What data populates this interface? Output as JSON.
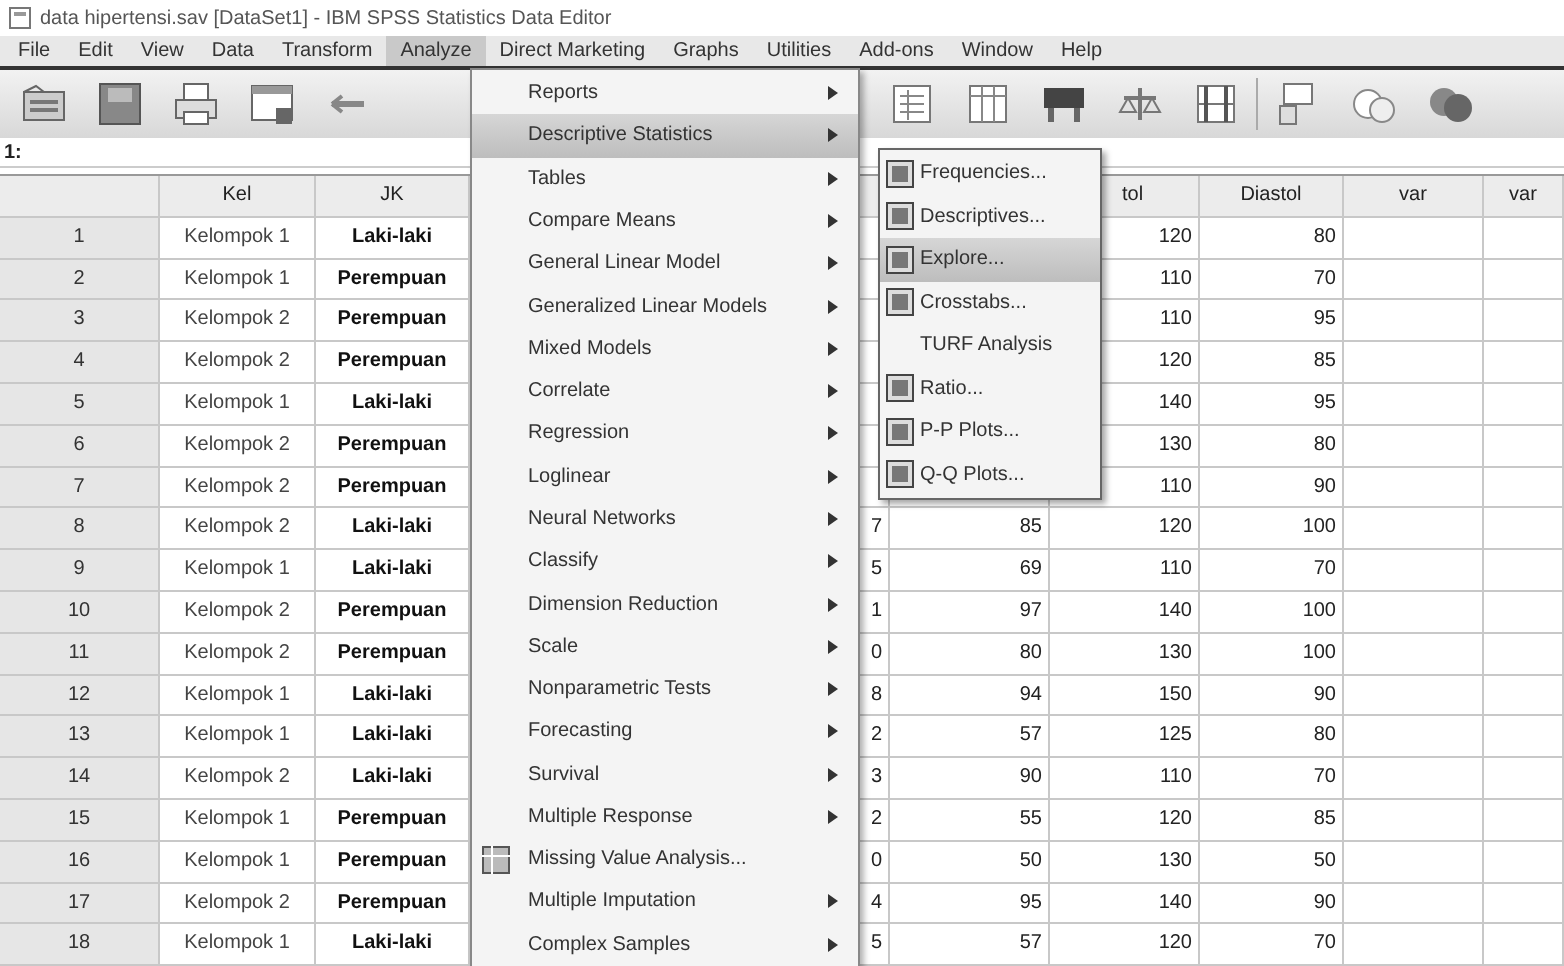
{
  "window": {
    "title": "data hipertensi.sav [DataSet1] - IBM SPSS Statistics Data Editor"
  },
  "menubar": [
    {
      "label": "File",
      "selected": false
    },
    {
      "label": "Edit",
      "selected": false
    },
    {
      "label": "View",
      "selected": false
    },
    {
      "label": "Data",
      "selected": false
    },
    {
      "label": "Transform",
      "selected": false
    },
    {
      "label": "Analyze",
      "selected": true
    },
    {
      "label": "Direct Marketing",
      "selected": false
    },
    {
      "label": "Graphs",
      "selected": false
    },
    {
      "label": "Utilities",
      "selected": false
    },
    {
      "label": "Add-ons",
      "selected": false
    },
    {
      "label": "Window",
      "selected": false
    },
    {
      "label": "Help",
      "selected": false
    }
  ],
  "cell_reference": "1:",
  "table": {
    "columns": [
      "Kel",
      "JK",
      "tol",
      "Diastol",
      "var",
      "var"
    ],
    "rows": [
      {
        "number": "1",
        "kelompok": "Kelompok 1",
        "jk": "Laki-laki",
        "sistol": "120",
        "diastol": "80"
      },
      {
        "number": "2",
        "kelompok": "Kelompok 1",
        "jk": "Perempuan",
        "sistol": "110",
        "diastol": "70"
      },
      {
        "number": "3",
        "kelompok": "Kelompok 2",
        "jk": "Perempuan",
        "sistol": "110",
        "diastol": "95"
      },
      {
        "number": "4",
        "kelompok": "Kelompok 2",
        "jk": "Perempuan",
        "sistol": "120",
        "diastol": "85"
      },
      {
        "number": "5",
        "kelompok": "Kelompok 1",
        "jk": "Laki-laki",
        "sistol": "140",
        "diastol": "95"
      },
      {
        "number": "6",
        "kelompok": "Kelompok 2",
        "jk": "Perempuan",
        "sistol": "130",
        "diastol": "80"
      },
      {
        "number": "7",
        "kelompok": "Kelompok 2",
        "jk": "Perempuan",
        "sistol": "110",
        "diastol": "90"
      },
      {
        "number": "8",
        "kelompok": "Kelompok 2",
        "jk": "Laki-laki",
        "column_5": "7",
        "column_6": "85",
        "sistol": "120",
        "diastol": "100"
      },
      {
        "number": "9",
        "kelompok": "Kelompok 1",
        "jk": "Laki-laki",
        "column_5": "5",
        "column_6": "69",
        "sistol": "110",
        "diastol": "70"
      },
      {
        "number": "10",
        "kelompok": "Kelompok 2",
        "jk": "Perempuan",
        "column_5": "1",
        "column_6": "97",
        "sistol": "140",
        "diastol": "100"
      },
      {
        "number": "11",
        "kelompok": "Kelompok 2",
        "jk": "Perempuan",
        "column_5": "0",
        "column_6": "80",
        "sistol": "130",
        "diastol": "100"
      },
      {
        "number": "12",
        "kelompok": "Kelompok 1",
        "jk": "Laki-laki",
        "column_5": "8",
        "column_6": "94",
        "sistol": "150",
        "diastol": "90"
      },
      {
        "number": "13",
        "kelompok": "Kelompok 1",
        "jk": "Laki-laki",
        "column_5": "2",
        "column_6": "57",
        "sistol": "125",
        "diastol": "80"
      },
      {
        "number": "14",
        "kelompok": "Kelompok 2",
        "jk": "Laki-laki",
        "column_5": "3",
        "column_6": "90",
        "sistol": "110",
        "diastol": "70"
      },
      {
        "number": "15",
        "kelompok": "Kelompok 1",
        "jk": "Perempuan",
        "column_5": "2",
        "column_6": "55",
        "sistol": "120",
        "diastol": "85"
      },
      {
        "number": "16",
        "kelompok": "Kelompok 1",
        "jk": "Perempuan",
        "column_5": "0",
        "column_6": "50",
        "sistol": "130",
        "diastol": "50"
      },
      {
        "number": "17",
        "kelompok": "Kelompok 2",
        "jk": "Perempuan",
        "column_5": "4",
        "column_6": "95",
        "sistol": "140",
        "diastol": "90"
      },
      {
        "number": "18",
        "kelompok": "Kelompok 1",
        "jk": "Laki-laki",
        "column_5": "5",
        "column_6": "57",
        "sistol": "120",
        "diastol": "70"
      }
    ]
  },
  "analyze_menu": [
    {
      "label": "Reports",
      "submenu": true,
      "selected": false,
      "icon": false
    },
    {
      "label": "Descriptive Statistics",
      "submenu": true,
      "selected": true,
      "icon": false
    },
    {
      "label": "Tables",
      "submenu": true,
      "selected": false,
      "icon": false
    },
    {
      "label": "Compare Means",
      "submenu": true,
      "selected": false,
      "icon": false
    },
    {
      "label": "General Linear Model",
      "submenu": true,
      "selected": false,
      "icon": false
    },
    {
      "label": "Generalized Linear Models",
      "submenu": true,
      "selected": false,
      "icon": false
    },
    {
      "label": "Mixed Models",
      "submenu": true,
      "selected": false,
      "icon": false
    },
    {
      "label": "Correlate",
      "submenu": true,
      "selected": false,
      "icon": false
    },
    {
      "label": "Regression",
      "submenu": true,
      "selected": false,
      "icon": false
    },
    {
      "label": "Loglinear",
      "submenu": true,
      "selected": false,
      "icon": false
    },
    {
      "label": "Neural Networks",
      "submenu": true,
      "selected": false,
      "icon": false
    },
    {
      "label": "Classify",
      "submenu": true,
      "selected": false,
      "icon": false
    },
    {
      "label": "Dimension Reduction",
      "submenu": true,
      "selected": false,
      "icon": false
    },
    {
      "label": "Scale",
      "submenu": true,
      "selected": false,
      "icon": false
    },
    {
      "label": "Nonparametric Tests",
      "submenu": true,
      "selected": false,
      "icon": false
    },
    {
      "label": "Forecasting",
      "submenu": true,
      "selected": false,
      "icon": false
    },
    {
      "label": "Survival",
      "submenu": true,
      "selected": false,
      "icon": false
    },
    {
      "label": "Multiple Response",
      "submenu": true,
      "selected": false,
      "icon": false
    },
    {
      "label": "Missing Value Analysis...",
      "submenu": false,
      "selected": false,
      "icon": true
    },
    {
      "label": "Multiple Imputation",
      "submenu": true,
      "selected": false,
      "icon": false
    },
    {
      "label": "Complex Samples",
      "submenu": true,
      "selected": false,
      "icon": false
    }
  ],
  "descriptive_submenu": [
    {
      "label": "Frequencies...",
      "selected": false,
      "icon": true
    },
    {
      "label": "Descriptives...",
      "selected": false,
      "icon": true
    },
    {
      "label": "Explore...",
      "selected": true,
      "icon": true
    },
    {
      "label": "Crosstabs...",
      "selected": false,
      "icon": true
    },
    {
      "label": "TURF Analysis",
      "selected": false,
      "icon": false
    },
    {
      "label": "Ratio...",
      "selected": false,
      "icon": true
    },
    {
      "label": "P-P Plots...",
      "selected": false,
      "icon": true
    },
    {
      "label": "Q-Q Plots...",
      "selected": false,
      "icon": true
    }
  ]
}
